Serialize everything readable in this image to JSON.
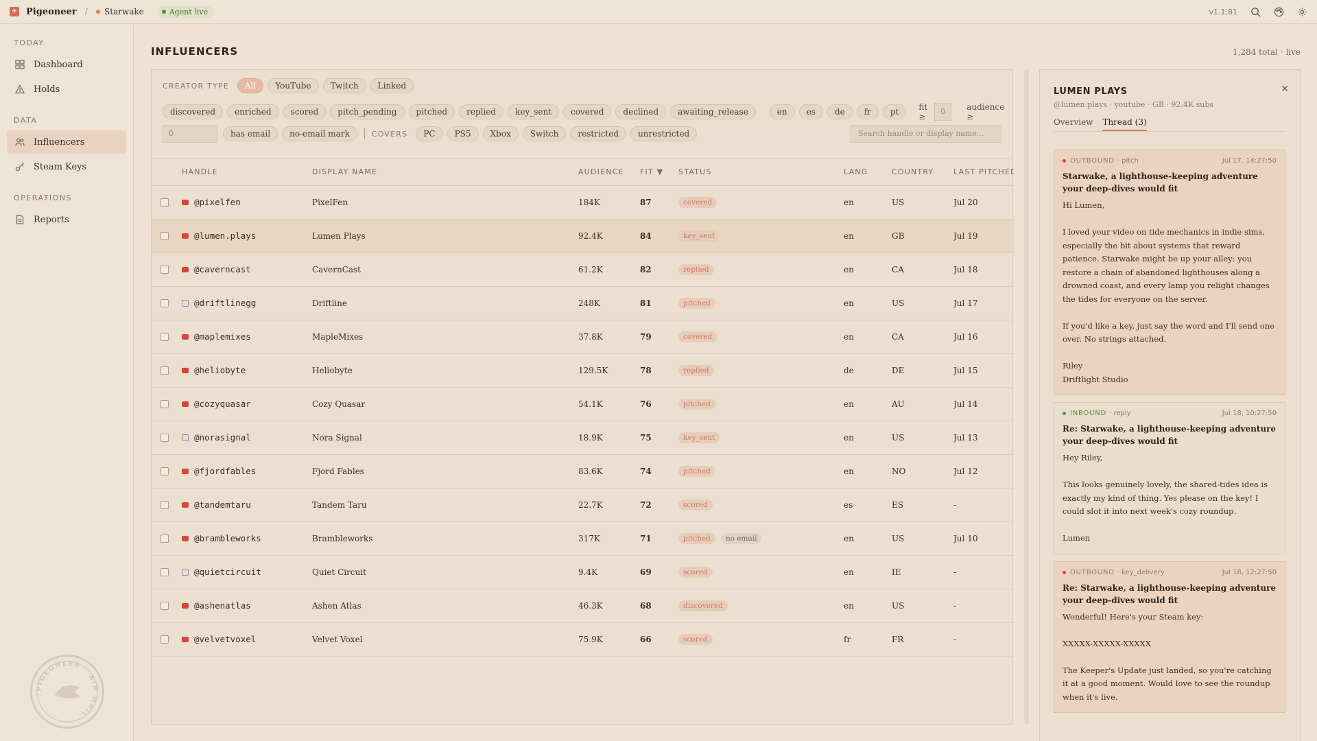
{
  "topbar": {
    "brand": "Pigeoneer",
    "separator": "/",
    "project": "Starwake",
    "agent_status": "Agent live",
    "version": "v1.1.81"
  },
  "sidebar": {
    "sections": [
      {
        "title": "TODAY",
        "items": [
          {
            "label": "Dashboard",
            "icon": "dashboard-icon"
          },
          {
            "label": "Holds",
            "icon": "warning-icon"
          }
        ]
      },
      {
        "title": "DATA",
        "items": [
          {
            "label": "Influencers",
            "icon": "users-icon"
          },
          {
            "label": "Steam Keys",
            "icon": "key-icon"
          }
        ]
      },
      {
        "title": "OPERATIONS",
        "items": [
          {
            "label": "Reports",
            "icon": "document-icon"
          }
        ]
      }
    ],
    "active": "Influencers"
  },
  "page": {
    "title": "INFLUENCERS",
    "meta": "1,284 total · live"
  },
  "filters": {
    "creator_type_label": "CREATOR TYPE",
    "creator_types": [
      "All",
      "YouTube",
      "Twitch",
      "Linked"
    ],
    "selected_creator_type": "All",
    "statuses": [
      "discovered",
      "enriched",
      "scored",
      "pitch_pending",
      "pitched",
      "replied",
      "key_sent",
      "covered",
      "declined",
      "awaiting_release"
    ],
    "languages": [
      "en",
      "es",
      "de",
      "fr",
      "pt"
    ],
    "fit_label": "fit ≥",
    "fit_placeholder": "0",
    "audience_label": "audience ≥",
    "audience_placeholder": "0",
    "has_email": "has email",
    "no_email_mark": "no-email mark",
    "covers_label": "COVERS",
    "platforms": [
      "PC",
      "PS5",
      "Xbox",
      "Switch"
    ],
    "restricted": "restricted",
    "unrestricted": "unrestricted",
    "search_placeholder": "Search handle or display name..."
  },
  "table": {
    "columns": [
      "HANDLE",
      "DISPLAY NAME",
      "AUDIENCE",
      "FIT ▼",
      "STATUS",
      "LANG",
      "COUNTRY",
      "LAST PITCHED"
    ],
    "rows": [
      {
        "platform": "youtube",
        "handle": "@pixelfen",
        "display": "PixelFen",
        "audience": "184K",
        "fit": "87",
        "status": "covered",
        "extra": "",
        "lang": "en",
        "country": "US",
        "last": "Jul 20"
      },
      {
        "platform": "youtube",
        "handle": "@lumen.plays",
        "display": "Lumen Plays",
        "audience": "92.4K",
        "fit": "84",
        "status": "key_sent",
        "extra": "",
        "lang": "en",
        "country": "GB",
        "last": "Jul 19"
      },
      {
        "platform": "youtube",
        "handle": "@caverncast",
        "display": "CavernCast",
        "audience": "61.2K",
        "fit": "82",
        "status": "replied",
        "extra": "",
        "lang": "en",
        "country": "CA",
        "last": "Jul 18"
      },
      {
        "platform": "twitch",
        "handle": "@driftlinegg",
        "display": "Driftline",
        "audience": "248K",
        "fit": "81",
        "status": "pitched",
        "extra": "",
        "lang": "en",
        "country": "US",
        "last": "Jul 17"
      },
      {
        "platform": "youtube",
        "handle": "@maplemixes",
        "display": "MapleMixes",
        "audience": "37.8K",
        "fit": "79",
        "status": "covered",
        "extra": "",
        "lang": "en",
        "country": "CA",
        "last": "Jul 16"
      },
      {
        "platform": "youtube",
        "handle": "@heliobyte",
        "display": "Heliobyte",
        "audience": "129.5K",
        "fit": "78",
        "status": "replied",
        "extra": "",
        "lang": "de",
        "country": "DE",
        "last": "Jul 15"
      },
      {
        "platform": "youtube",
        "handle": "@cozyquasar",
        "display": "Cozy Quasar",
        "audience": "54.1K",
        "fit": "76",
        "status": "pitched",
        "extra": "",
        "lang": "en",
        "country": "AU",
        "last": "Jul 14"
      },
      {
        "platform": "twitch",
        "handle": "@norasignal",
        "display": "Nora Signal",
        "audience": "18.9K",
        "fit": "75",
        "status": "key_sent",
        "extra": "",
        "lang": "en",
        "country": "US",
        "last": "Jul 13"
      },
      {
        "platform": "youtube",
        "handle": "@fjordfables",
        "display": "Fjord Fables",
        "audience": "83.6K",
        "fit": "74",
        "status": "pitched",
        "extra": "",
        "lang": "en",
        "country": "NO",
        "last": "Jul 12"
      },
      {
        "platform": "youtube",
        "handle": "@tandemtaru",
        "display": "Tandem Taru",
        "audience": "22.7K",
        "fit": "72",
        "status": "scored",
        "extra": "",
        "lang": "es",
        "country": "ES",
        "last": "-"
      },
      {
        "platform": "youtube",
        "handle": "@brambleworks",
        "display": "Brambleworks",
        "audience": "317K",
        "fit": "71",
        "status": "pitched",
        "extra": "no email",
        "lang": "en",
        "country": "US",
        "last": "Jul 10"
      },
      {
        "platform": "twitch",
        "handle": "@quietcircuit",
        "display": "Quiet Circuit",
        "audience": "9.4K",
        "fit": "69",
        "status": "scored",
        "extra": "",
        "lang": "en",
        "country": "IE",
        "last": "-"
      },
      {
        "platform": "youtube",
        "handle": "@ashenatlas",
        "display": "Ashen Atlas",
        "audience": "46.3K",
        "fit": "68",
        "status": "discovered",
        "extra": "",
        "lang": "en",
        "country": "US",
        "last": "-"
      },
      {
        "platform": "youtube",
        "handle": "@velvetvoxel",
        "display": "Velvet Voxel",
        "audience": "75.9K",
        "fit": "66",
        "status": "scored",
        "extra": "",
        "lang": "fr",
        "country": "FR",
        "last": "-"
      }
    ],
    "highlighted_row": 1
  },
  "detail": {
    "title": "LUMEN PLAYS",
    "subtitle": "@lumen.plays · youtube · GB · 92.4K subs",
    "close": "✕",
    "tabs": [
      "Overview",
      "Thread (3)"
    ],
    "active_tab": "Thread (3)",
    "messages": [
      {
        "direction": "out",
        "direction_label": "OUTBOUND",
        "kind": "· pitch",
        "time": "Jul 17, 14:27:50",
        "subject": "Starwake, a lighthouse-keeping adventure your deep-dives would fit",
        "body": "Hi Lumen,\n\nI loved your video on tide mechanics in indie sims, especially the bit about systems that reward patience. Starwake might be up your alley: you restore a chain of abandoned lighthouses along a drowned coast, and every lamp you relight changes the tides for everyone on the server.\n\nIf you'd like a key, just say the word and I'll send one over. No strings attached.\n\nRiley\nDriftlight Studio"
      },
      {
        "direction": "in",
        "direction_label": "INBOUND",
        "kind": "· reply",
        "time": "Jul 18, 10:27:50",
        "subject": "Re: Starwake, a lighthouse-keeping adventure your deep-dives would fit",
        "body": "Hey Riley,\n\nThis looks genuinely lovely, the shared-tides idea is exactly my kind of thing. Yes please on the key! I could slot it into next week's cozy roundup.\n\nLumen"
      },
      {
        "direction": "out",
        "direction_label": "OUTBOUND",
        "kind": "· key_delivery",
        "time": "Jul 18, 12:27:50",
        "subject": "Re: Starwake, a lighthouse-keeping adventure your deep-dives would fit",
        "body": "Wonderful! Here's your Steam key:\n\nXXXXX-XXXXX-XXXXX\n\nThe Keeper's Update just landed, so you're catching it at a good moment. Would love to see the roundup when it's live."
      }
    ]
  },
  "stamp_text": "PIGEONEER · AIR MAIL"
}
